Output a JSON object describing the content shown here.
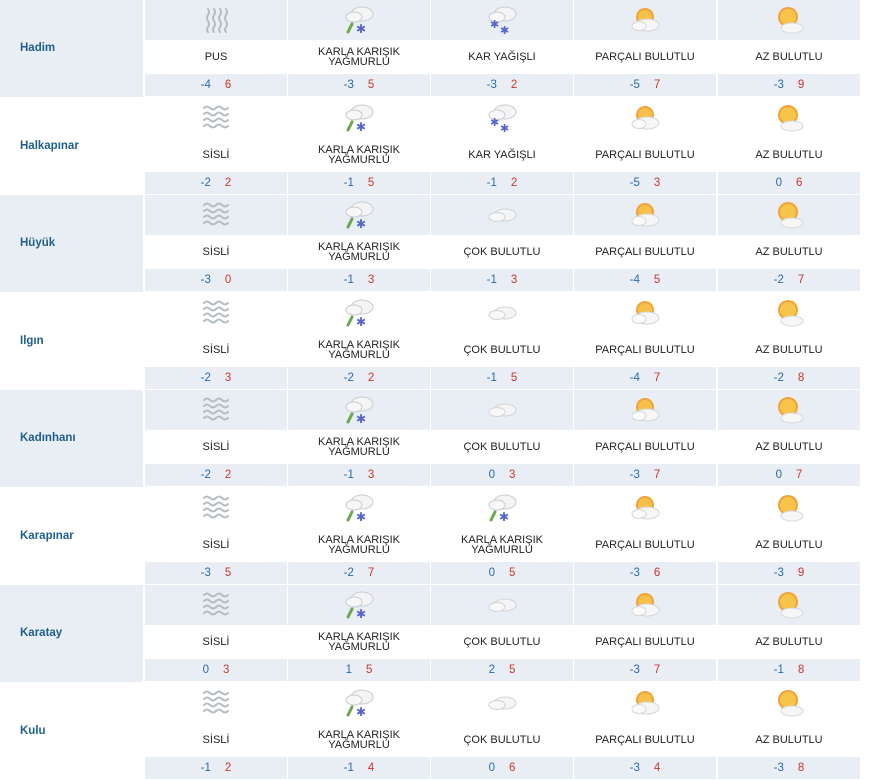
{
  "forecast": {
    "rows": [
      {
        "city": "Hadim",
        "days": [
          {
            "icon": "fog-icon",
            "cond": "PUS",
            "min": "-4",
            "max": "6"
          },
          {
            "icon": "sleet-icon",
            "cond": "KARLA KARIŞIK YAĞMURLU",
            "min": "-3",
            "max": "5"
          },
          {
            "icon": "snow-icon",
            "cond": "KAR YAĞIŞLI",
            "min": "-3",
            "max": "2"
          },
          {
            "icon": "partly-cloudy-icon",
            "cond": "PARÇALI BULUTLU",
            "min": "-5",
            "max": "7"
          },
          {
            "icon": "mostly-sunny-icon",
            "cond": "AZ BULUTLU",
            "min": "-3",
            "max": "9"
          }
        ]
      },
      {
        "city": "Halkapınar",
        "days": [
          {
            "icon": "mist-icon",
            "cond": "SİSLİ",
            "min": "-2",
            "max": "2"
          },
          {
            "icon": "sleet-icon",
            "cond": "KARLA KARIŞIK YAĞMURLU",
            "min": "-1",
            "max": "5"
          },
          {
            "icon": "snow-icon",
            "cond": "KAR YAĞIŞLI",
            "min": "-1",
            "max": "2"
          },
          {
            "icon": "partly-cloudy-icon",
            "cond": "PARÇALI BULUTLU",
            "min": "-5",
            "max": "3"
          },
          {
            "icon": "mostly-sunny-icon",
            "cond": "AZ BULUTLU",
            "min": "0",
            "max": "6"
          }
        ]
      },
      {
        "city": "Hüyük",
        "days": [
          {
            "icon": "mist-icon",
            "cond": "SİSLİ",
            "min": "-3",
            "max": "0"
          },
          {
            "icon": "sleet-icon",
            "cond": "KARLA KARIŞIK YAĞMURLU",
            "min": "-1",
            "max": "3"
          },
          {
            "icon": "cloudy-icon",
            "cond": "ÇOK BULUTLU",
            "min": "-1",
            "max": "3"
          },
          {
            "icon": "partly-cloudy-icon",
            "cond": "PARÇALI BULUTLU",
            "min": "-4",
            "max": "5"
          },
          {
            "icon": "mostly-sunny-icon",
            "cond": "AZ BULUTLU",
            "min": "-2",
            "max": "7"
          }
        ]
      },
      {
        "city": "Ilgın",
        "days": [
          {
            "icon": "mist-icon",
            "cond": "SİSLİ",
            "min": "-2",
            "max": "3"
          },
          {
            "icon": "sleet-icon",
            "cond": "KARLA KARIŞIK YAĞMURLU",
            "min": "-2",
            "max": "2"
          },
          {
            "icon": "cloudy-icon",
            "cond": "ÇOK BULUTLU",
            "min": "-1",
            "max": "5"
          },
          {
            "icon": "partly-cloudy-icon",
            "cond": "PARÇALI BULUTLU",
            "min": "-4",
            "max": "7"
          },
          {
            "icon": "mostly-sunny-icon",
            "cond": "AZ BULUTLU",
            "min": "-2",
            "max": "8"
          }
        ]
      },
      {
        "city": "Kadınhanı",
        "days": [
          {
            "icon": "mist-icon",
            "cond": "SİSLİ",
            "min": "-2",
            "max": "2"
          },
          {
            "icon": "sleet-icon",
            "cond": "KARLA KARIŞIK YAĞMURLU",
            "min": "-1",
            "max": "3"
          },
          {
            "icon": "cloudy-icon",
            "cond": "ÇOK BULUTLU",
            "min": "0",
            "max": "3"
          },
          {
            "icon": "partly-cloudy-icon",
            "cond": "PARÇALI BULUTLU",
            "min": "-3",
            "max": "7"
          },
          {
            "icon": "mostly-sunny-icon",
            "cond": "AZ BULUTLU",
            "min": "0",
            "max": "7"
          }
        ]
      },
      {
        "city": "Karapınar",
        "days": [
          {
            "icon": "mist-icon",
            "cond": "SİSLİ",
            "min": "-3",
            "max": "5"
          },
          {
            "icon": "sleet-icon",
            "cond": "KARLA KARIŞIK YAĞMURLU",
            "min": "-2",
            "max": "7"
          },
          {
            "icon": "sleet-icon",
            "cond": "KARLA KARIŞIK YAĞMURLU",
            "min": "0",
            "max": "5"
          },
          {
            "icon": "partly-cloudy-icon",
            "cond": "PARÇALI BULUTLU",
            "min": "-3",
            "max": "6"
          },
          {
            "icon": "mostly-sunny-icon",
            "cond": "AZ BULUTLU",
            "min": "-3",
            "max": "9"
          }
        ]
      },
      {
        "city": "Karatay",
        "days": [
          {
            "icon": "mist-icon",
            "cond": "SİSLİ",
            "min": "0",
            "max": "3"
          },
          {
            "icon": "sleet-icon",
            "cond": "KARLA KARIŞIK YAĞMURLU",
            "min": "1",
            "max": "5"
          },
          {
            "icon": "cloudy-icon",
            "cond": "ÇOK BULUTLU",
            "min": "2",
            "max": "5"
          },
          {
            "icon": "partly-cloudy-icon",
            "cond": "PARÇALI BULUTLU",
            "min": "-3",
            "max": "7"
          },
          {
            "icon": "mostly-sunny-icon",
            "cond": "AZ BULUTLU",
            "min": "-1",
            "max": "8"
          }
        ]
      },
      {
        "city": "Kulu",
        "days": [
          {
            "icon": "mist-icon",
            "cond": "SİSLİ",
            "min": "-1",
            "max": "2"
          },
          {
            "icon": "sleet-icon",
            "cond": "KARLA KARIŞIK YAĞMURLU",
            "min": "-1",
            "max": "4"
          },
          {
            "icon": "cloudy-icon",
            "cond": "ÇOK BULUTLU",
            "min": "0",
            "max": "6"
          },
          {
            "icon": "partly-cloudy-icon",
            "cond": "PARÇALI BULUTLU",
            "min": "-3",
            "max": "4"
          },
          {
            "icon": "mostly-sunny-icon",
            "cond": "AZ BULUTLU",
            "min": "-3",
            "max": "8"
          }
        ]
      }
    ]
  },
  "colors": {
    "band": "#e8eef3",
    "city": "#1f5f8b",
    "min": "#2a6aa8",
    "max": "#d0342c"
  }
}
